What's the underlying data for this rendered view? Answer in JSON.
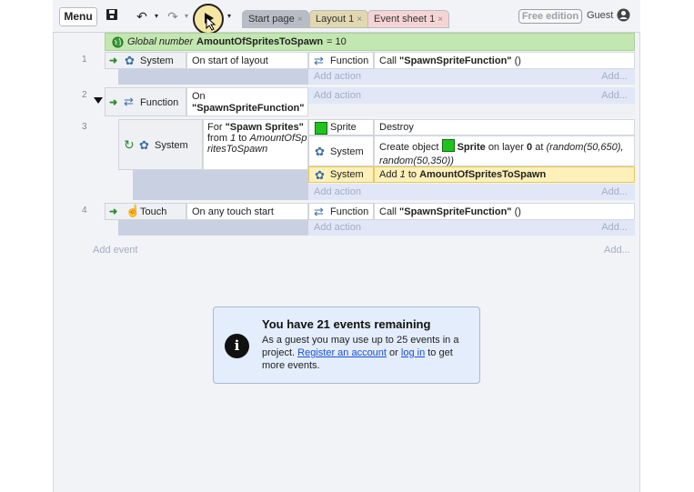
{
  "toolbar": {
    "menu_label": "Menu",
    "tabs": [
      {
        "label": "Start page",
        "close": "×"
      },
      {
        "label": "Layout 1",
        "close": "×"
      },
      {
        "label": "Event sheet 1",
        "close": "×"
      }
    ],
    "free_badge": "Free edition",
    "guest_label": "Guest"
  },
  "global_var": {
    "prefix": "Global number",
    "name": "AmountOfSpritesToSpawn",
    "suffix": "= 10"
  },
  "events": [
    {
      "number": "1",
      "object": "System",
      "condition": "On start of layout",
      "actions": [
        {
          "object": "Function",
          "text_pre": "Call",
          "text_bold": "\"SpawnSpriteFunction\"",
          "text_post": "()"
        }
      ]
    },
    {
      "number": "2",
      "object": "Function",
      "condition_line1": "On",
      "condition_line2": "\"SpawnSpriteFunction\""
    },
    {
      "number": "3",
      "object": "System",
      "condition_pre": "For",
      "condition_bold": "\"Spawn Sprites\"",
      "condition_mid": "from",
      "condition_from": "1",
      "condition_to_label": "to",
      "condition_to": "AmountOfSpritesToSpawn",
      "actions": [
        {
          "object": "Sprite",
          "text": "Destroy"
        },
        {
          "object": "System",
          "text_pre": "Create object",
          "text_obj": "Sprite",
          "text_post": "on layer",
          "layer": "0",
          "at": "at",
          "coords": "(random(50,650), random(50,350))"
        },
        {
          "object": "System",
          "text_pre": "Add",
          "text_num": "1",
          "text_to": "to",
          "text_var": "AmountOfSpritesToSpawn"
        }
      ]
    },
    {
      "number": "4",
      "object": "Touch",
      "condition": "On any touch start",
      "actions": [
        {
          "object": "Function",
          "text_pre": "Call",
          "text_bold": "\"SpawnSpriteFunction\"",
          "text_post": "()"
        }
      ]
    }
  ],
  "add_action": "Add action",
  "add_short": "Add...",
  "add_event": "Add event",
  "notice": {
    "title": "You have 21 events remaining",
    "line_pre": "As a guest you may use up to 25 events in a project.",
    "register_link": "Register an account",
    "or_text": "or",
    "login_link": "log in",
    "line_post": "to get more events."
  }
}
